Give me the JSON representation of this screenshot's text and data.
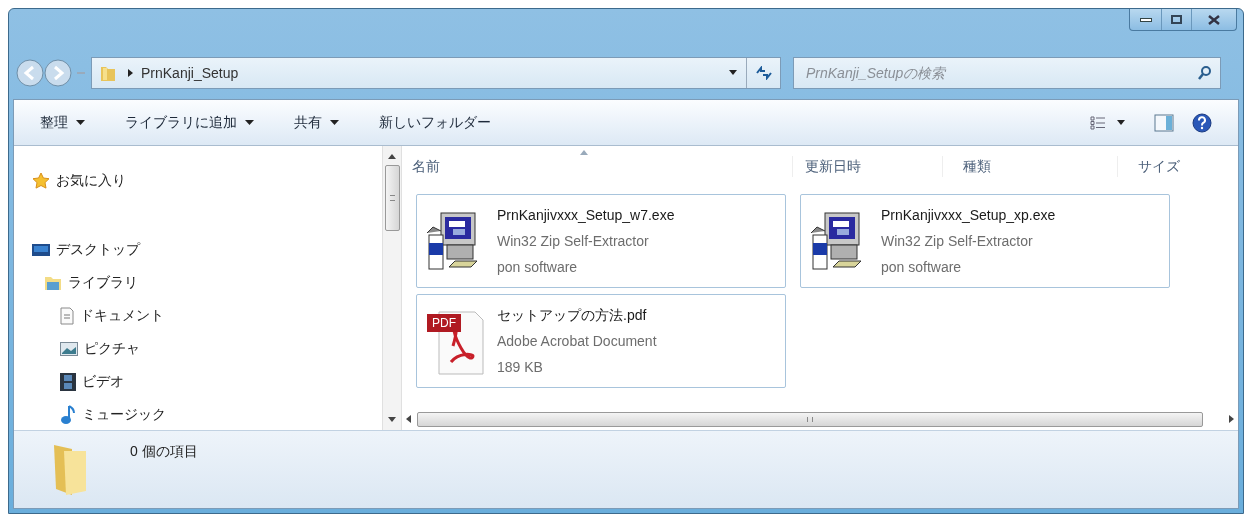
{
  "address_bar": {
    "path": "PrnKanji_Setup"
  },
  "search": {
    "placeholder": "PrnKanji_Setupの検索"
  },
  "toolbar": [
    {
      "label": "整理",
      "dropdown": true
    },
    {
      "label": "ライブラリに追加",
      "dropdown": true
    },
    {
      "label": "共有",
      "dropdown": true
    },
    {
      "label": "新しいフォルダー",
      "dropdown": false
    }
  ],
  "sidebar": {
    "items": [
      {
        "label": "お気に入り",
        "kind": "star"
      },
      {
        "label": "デスクトップ",
        "kind": "desktop",
        "children": [
          {
            "label": "ライブラリ",
            "kind": "library",
            "children": [
              {
                "label": "ドキュメント",
                "kind": "document"
              },
              {
                "label": "ピクチャ",
                "kind": "picture"
              },
              {
                "label": "ビデオ",
                "kind": "video"
              },
              {
                "label": "ミュージック",
                "kind": "music"
              }
            ]
          }
        ]
      }
    ]
  },
  "columns": [
    "名前",
    "更新日時",
    "種類",
    "サイズ"
  ],
  "files": [
    {
      "kind": "installer",
      "name": "PrnKanjivxxx_Setup_w7.exe",
      "type": "Win32 Zip Self-Extractor",
      "detail": "pon software"
    },
    {
      "kind": "installer",
      "name": "PrnKanjivxxx_Setup_xp.exe",
      "type": "Win32 Zip Self-Extractor",
      "detail": "pon software"
    },
    {
      "kind": "pdf",
      "icon_label": "PDF",
      "name": "セットアップの方法.pdf",
      "type": "Adobe Acrobat Document",
      "detail": "189 KB"
    }
  ],
  "status_bar": {
    "count": "0 個の項目"
  }
}
